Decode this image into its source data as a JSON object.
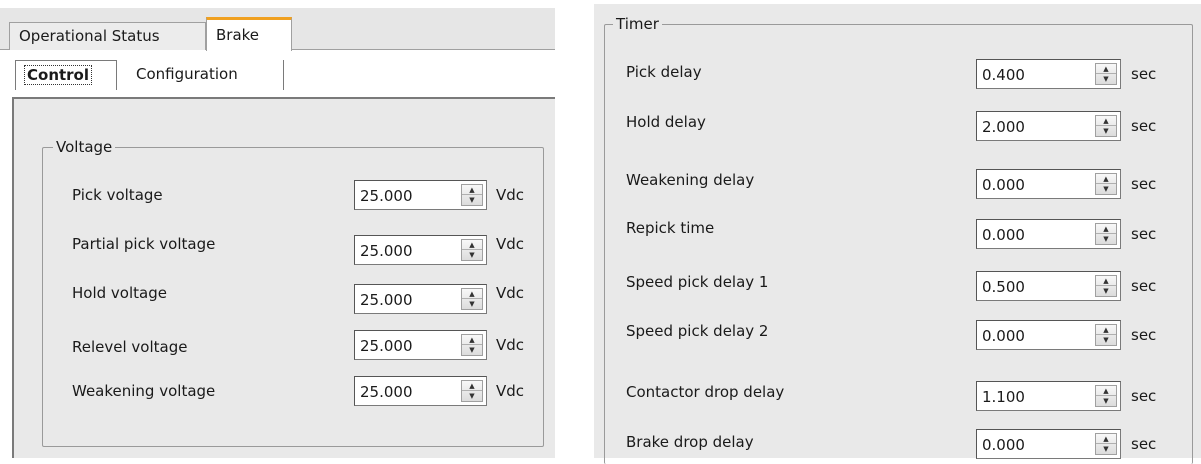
{
  "tabs": [
    {
      "label": "Operational Status"
    },
    {
      "label": "Brake"
    }
  ],
  "subtabs": [
    {
      "label": "Control"
    },
    {
      "label": "Configuration"
    }
  ],
  "voltage_group": {
    "title": "Voltage",
    "rows": [
      {
        "label": "Pick voltage",
        "value": "25.000",
        "unit": "Vdc"
      },
      {
        "label": "Partial pick voltage",
        "value": "25.000",
        "unit": "Vdc"
      },
      {
        "label": "Hold voltage",
        "value": "25.000",
        "unit": "Vdc"
      },
      {
        "label": "Relevel voltage",
        "value": "25.000",
        "unit": "Vdc"
      },
      {
        "label": "Weakening voltage",
        "value": "25.000",
        "unit": "Vdc"
      }
    ]
  },
  "timer_group": {
    "title": "Timer",
    "rows": [
      {
        "label": "Pick delay",
        "value": "0.400",
        "unit": "sec"
      },
      {
        "label": "Hold delay",
        "value": "2.000",
        "unit": "sec"
      },
      {
        "label": "Weakening delay",
        "value": "0.000",
        "unit": "sec"
      },
      {
        "label": "Repick time",
        "value": "0.000",
        "unit": "sec"
      },
      {
        "label": "Speed pick delay 1",
        "value": "0.500",
        "unit": "sec"
      },
      {
        "label": "Speed pick delay 2",
        "value": "0.000",
        "unit": "sec"
      },
      {
        "label": "Contactor drop delay",
        "value": "1.100",
        "unit": "sec"
      },
      {
        "label": "Brake drop delay",
        "value": "0.000",
        "unit": "sec"
      }
    ]
  },
  "colors": {
    "active_tab_accent": "#f0a020",
    "panel_bg": "#e9e9e9"
  }
}
